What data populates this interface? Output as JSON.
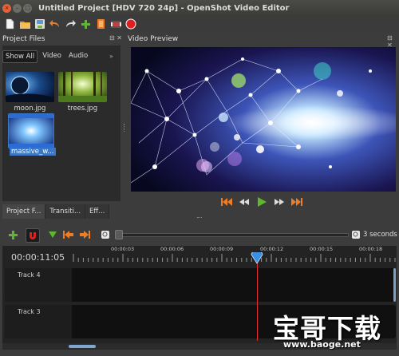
{
  "window": {
    "title": "Untitled Project [HDV 720 24p] - OpenShot Video Editor",
    "close_glyph": "×",
    "min_glyph": "–",
    "max_glyph": "□"
  },
  "toolbar": {
    "icons": [
      "new-file-icon",
      "open-folder-icon",
      "save-icon",
      "undo-icon",
      "redo-icon",
      "import-files-icon",
      "choose-profile-icon",
      "fullscreen-icon",
      "export-video-icon"
    ]
  },
  "project_files": {
    "title": "Project Files",
    "dock_controls": "⊟ ✕",
    "filters": [
      "Show All",
      "Video",
      "Audio"
    ],
    "more_glyph": "»",
    "files": [
      {
        "name": "moon.jpg"
      },
      {
        "name": "trees.jpg"
      },
      {
        "name": "massive_w..."
      }
    ]
  },
  "bottom_tabs": [
    "Project F...",
    "Transiti...",
    "Eff..."
  ],
  "video_preview": {
    "title": "Video Preview",
    "dock_controls": "⊟ ✕"
  },
  "playback": {
    "icons": [
      "jump-start-icon",
      "rewind-icon",
      "play-icon",
      "fast-forward-icon",
      "jump-end-icon"
    ]
  },
  "timeline": {
    "zoom_label": "3 seconds",
    "timecode": "00:00:11:05",
    "ruler_labels": [
      "00:00:03",
      "00:00:06",
      "00:00:09",
      "00:00:12",
      "00:00:15",
      "00:00:18"
    ],
    "tracks": [
      {
        "name": "Track 4"
      },
      {
        "name": "Track 3"
      }
    ],
    "playhead_seconds": 11.2
  },
  "watermark": {
    "text": "宝哥下载",
    "url": "www.baoge.net"
  },
  "colors": {
    "accent_orange": "#f07d21",
    "add_green": "#5db82d",
    "record_red": "#e02020",
    "playhead_red": "#e03030",
    "selection_blue": "#3d77c4"
  }
}
